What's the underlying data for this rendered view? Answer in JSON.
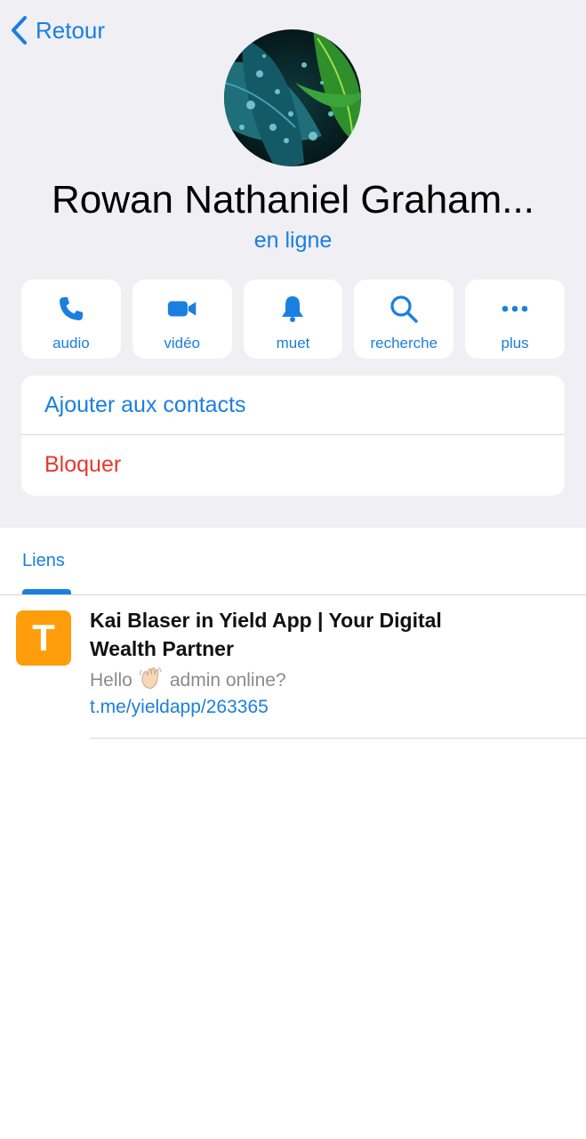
{
  "nav": {
    "back_label": "Retour"
  },
  "profile": {
    "name": "Rowan Nathaniel Graham...",
    "status": "en ligne"
  },
  "actions": [
    {
      "label": "audio",
      "icon": "phone-icon"
    },
    {
      "label": "vidéo",
      "icon": "video-icon"
    },
    {
      "label": "muet",
      "icon": "bell-icon"
    },
    {
      "label": "recherche",
      "icon": "search-icon"
    },
    {
      "label": "plus",
      "icon": "more-icon"
    }
  ],
  "options": {
    "add_contact": "Ajouter aux contacts",
    "block": "Bloquer"
  },
  "tabs": [
    {
      "label": "Liens",
      "active": true
    }
  ],
  "links": [
    {
      "thumb_letter": "T",
      "title": "Kai Blaser in Yield App | Your Digital Wealth Partner",
      "desc_prefix": "Hello",
      "desc_suffix": "admin online?",
      "url": "t.me/yieldapp/263365"
    }
  ],
  "colors": {
    "accent": "#1a7fe0",
    "danger": "#e5392d",
    "thumb": "#ff9d0a",
    "background": "#efeff4"
  }
}
